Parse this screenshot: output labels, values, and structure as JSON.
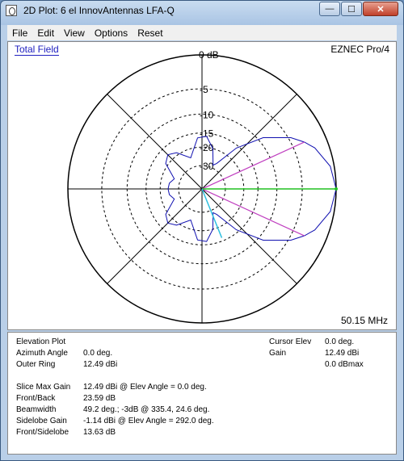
{
  "window": {
    "title": "2D Plot: 6 el InnovAntennas LFA-Q",
    "buttons": {
      "minimize": "—",
      "maximize": "☐",
      "close": "✕"
    }
  },
  "menu": [
    "File",
    "Edit",
    "View",
    "Options",
    "Reset"
  ],
  "plot": {
    "field_label": "Total Field",
    "program": "EZNEC Pro/4",
    "frequency": "50.15 MHz",
    "ring_labels": [
      "0 dB",
      "-5",
      "-10",
      "-15",
      "-20",
      "-30"
    ],
    "colors": {
      "pattern": "#1010b0",
      "beamwidth_lines": "#c040c0",
      "max_gain_line": "#20c020",
      "cursor_line": "#30c0e0",
      "grid": "#000000"
    }
  },
  "chart_data": {
    "type": "polar",
    "title": "Total Field",
    "scale": "dB",
    "ring_values_db": [
      0,
      -5,
      -10,
      -15,
      -20,
      -30
    ],
    "max_gain_angle_deg": 0.0,
    "beamwidth_edges_deg": [
      335.4,
      24.6
    ],
    "cursor_angle_deg": 292.0,
    "pattern": [
      {
        "angle": 0,
        "db": 0
      },
      {
        "angle": 10,
        "db": -0.5
      },
      {
        "angle": 20,
        "db": -1.9
      },
      {
        "angle": 24.6,
        "db": -3
      },
      {
        "angle": 30,
        "db": -4.6
      },
      {
        "angle": 40,
        "db": -8.9
      },
      {
        "angle": 50,
        "db": -15.8
      },
      {
        "angle": 60,
        "db": -26
      },
      {
        "angle": 65,
        "db": -28
      },
      {
        "angle": 75,
        "db": -20
      },
      {
        "angle": 85,
        "db": -16
      },
      {
        "angle": 95,
        "db": -16.5
      },
      {
        "angle": 110,
        "db": -24
      },
      {
        "angle": 125,
        "db": -19
      },
      {
        "angle": 135,
        "db": -17.5
      },
      {
        "angle": 145,
        "db": -19
      },
      {
        "angle": 160,
        "db": -26
      },
      {
        "angle": 170,
        "db": -24
      },
      {
        "angle": 180,
        "db": -23.6
      },
      {
        "angle": 190,
        "db": -24
      },
      {
        "angle": 200,
        "db": -26
      },
      {
        "angle": 215,
        "db": -19
      },
      {
        "angle": 225,
        "db": -17.5
      },
      {
        "angle": 235,
        "db": -19
      },
      {
        "angle": 250,
        "db": -24
      },
      {
        "angle": 265,
        "db": -16.5
      },
      {
        "angle": 275,
        "db": -16
      },
      {
        "angle": 285,
        "db": -20
      },
      {
        "angle": 295,
        "db": -28
      },
      {
        "angle": 300,
        "db": -26
      },
      {
        "angle": 310,
        "db": -15.8
      },
      {
        "angle": 320,
        "db": -8.9
      },
      {
        "angle": 330,
        "db": -4.6
      },
      {
        "angle": 335.4,
        "db": -3
      },
      {
        "angle": 340,
        "db": -1.9
      },
      {
        "angle": 350,
        "db": -0.5
      },
      {
        "angle": 360,
        "db": 0
      }
    ]
  },
  "info": {
    "plot_type": "Elevation Plot",
    "azimuth_label": "Azimuth Angle",
    "azimuth_value": "0.0 deg.",
    "outer_ring_label": "Outer Ring",
    "outer_ring_value": "12.49 dBi",
    "cursor_elev_label": "Cursor Elev",
    "cursor_elev_value": "0.0 deg.",
    "gain_label": "Gain",
    "gain_value": "12.49 dBi",
    "gain_dbmax": "0.0 dBmax",
    "slice_max_label": "Slice Max Gain",
    "slice_max_value": "12.49 dBi @ Elev Angle = 0.0 deg.",
    "front_back_label": "Front/Back",
    "front_back_value": "23.59 dB",
    "beamwidth_label": "Beamwidth",
    "beamwidth_value": "49.2 deg.; -3dB @ 335.4, 24.6 deg.",
    "sidelobe_label": "Sidelobe Gain",
    "sidelobe_value": "-1.14 dBi @ Elev Angle = 292.0 deg.",
    "front_side_label": "Front/Sidelobe",
    "front_side_value": "13.63 dB"
  }
}
